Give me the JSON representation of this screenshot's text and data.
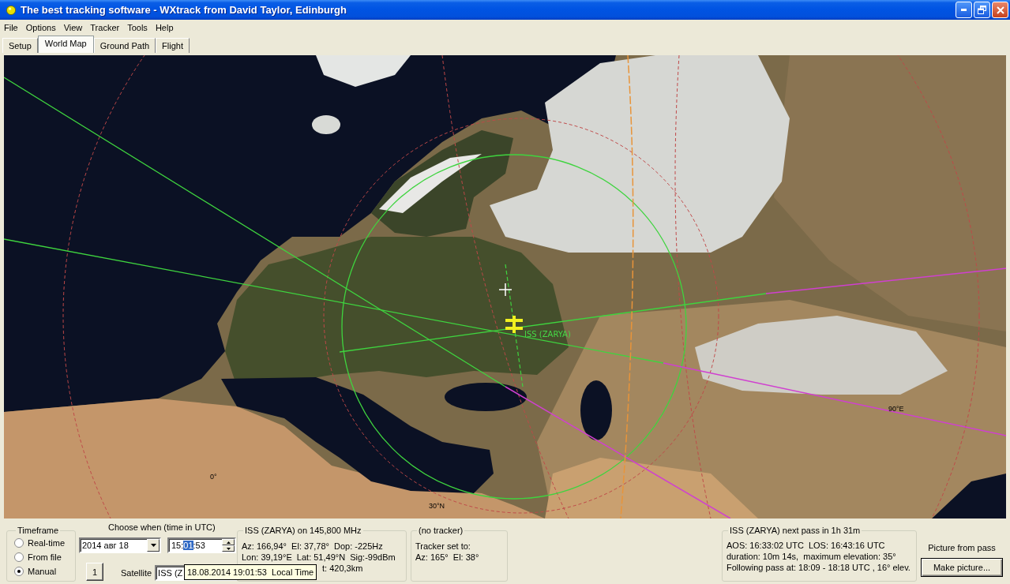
{
  "window": {
    "title": "The best tracking software - WXtrack from David Taylor, Edinburgh"
  },
  "menu": [
    "File",
    "Options",
    "View",
    "Tracker",
    "Tools",
    "Help"
  ],
  "tabs": [
    {
      "label": "Setup",
      "selected": false
    },
    {
      "label": "World Map",
      "selected": true
    },
    {
      "label": "Ground Path",
      "selected": false
    },
    {
      "label": "Flight",
      "selected": false
    }
  ],
  "map": {
    "satellite_label": "ISS (ZARYA)",
    "grid_labels": [
      "0°",
      "30°N",
      "90°E"
    ]
  },
  "timeframe": {
    "title": "Timeframe",
    "options": [
      {
        "label": "Real-time",
        "selected": false
      },
      {
        "label": "From file",
        "selected": false
      },
      {
        "label": "Manual",
        "selected": true
      }
    ]
  },
  "chooser": {
    "title": "Choose when (time in UTC)",
    "date": "2014 авг 18",
    "time": [
      {
        "text": "15:",
        "selected": false
      },
      {
        "text": "01",
        "selected": true
      },
      {
        "text": ":53",
        "selected": false
      }
    ],
    "step_button": "1",
    "satellite_label": "Satellite",
    "satellite_value": "ISS (Z",
    "tooltip": "18.08.2014 19:01:53  Local Time"
  },
  "satellite_panel": {
    "title": "ISS (ZARYA) on 145,800 MHz",
    "lines": [
      "Az: 166,94°  El: 37,78°  Dop: -225Hz",
      "Lon: 39,19°E  Lat: 51,49°N  Sig:-99dBm",
      "t: 420,3km"
    ]
  },
  "tracker_panel": {
    "title": "(no tracker)",
    "lines": [
      "Tracker set to:",
      "Az: 165°  El: 38°"
    ]
  },
  "next_pass_panel": {
    "title": "ISS (ZARYA) next pass in 1h 31m",
    "lines": [
      "AOS: 16:33:02 UTC  LOS: 16:43:16 UTC",
      "duration: 10m 14s,  maximum elevation: 35°",
      "Following pass at: 18:09 - 18:18 UTC , 16° elev."
    ]
  },
  "picture": {
    "label": "Picture from pass",
    "button": "Make picture..."
  }
}
